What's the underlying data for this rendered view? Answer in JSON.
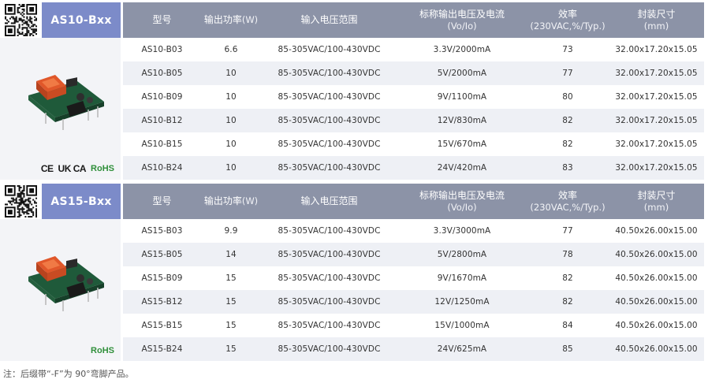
{
  "columns": [
    {
      "main": "型号",
      "sub": ""
    },
    {
      "main": "输出功率",
      "sub": "(W)"
    },
    {
      "main": "输入电压范围",
      "sub": ""
    },
    {
      "main": "标称输出电压及电流",
      "sub": "(Vo/Io)"
    },
    {
      "main": "效率",
      "sub": "(230VAC,%/Typ.)"
    },
    {
      "main": "封装尺寸",
      "sub": "(mm)"
    }
  ],
  "sections": [
    {
      "series": "AS10-Bxx",
      "certs": {
        "ce": "CE",
        "ukca": "UK CA",
        "rohs": "RoHS"
      },
      "rows": [
        [
          "AS10-B03",
          "6.6",
          "85-305VAC/100-430VDC",
          "3.3V/2000mA",
          "73",
          "32.00x17.20x15.05"
        ],
        [
          "AS10-B05",
          "10",
          "85-305VAC/100-430VDC",
          "5V/2000mA",
          "77",
          "32.00x17.20x15.05"
        ],
        [
          "AS10-B09",
          "10",
          "85-305VAC/100-430VDC",
          "9V/1100mA",
          "80",
          "32.00x17.20x15.05"
        ],
        [
          "AS10-B12",
          "10",
          "85-305VAC/100-430VDC",
          "12V/830mA",
          "82",
          "32.00x17.20x15.05"
        ],
        [
          "AS10-B15",
          "10",
          "85-305VAC/100-430VDC",
          "15V/670mA",
          "82",
          "32.00x17.20x15.05"
        ],
        [
          "AS10-B24",
          "10",
          "85-305VAC/100-430VDC",
          "24V/420mA",
          "83",
          "32.00x17.20x15.05"
        ]
      ]
    },
    {
      "series": "AS15-Bxx",
      "certs": {
        "rohs": "RoHS"
      },
      "rows": [
        [
          "AS15-B03",
          "9.9",
          "85-305VAC/100-430VDC",
          "3.3V/3000mA",
          "77",
          "40.50x26.00x15.00"
        ],
        [
          "AS15-B05",
          "14",
          "85-305VAC/100-430VDC",
          "5V/2800mA",
          "78",
          "40.50x26.00x15.00"
        ],
        [
          "AS15-B09",
          "15",
          "85-305VAC/100-430VDC",
          "9V/1670mA",
          "82",
          "40.50x26.00x15.00"
        ],
        [
          "AS15-B12",
          "15",
          "85-305VAC/100-430VDC",
          "12V/1250mA",
          "82",
          "40.50x26.00x15.00"
        ],
        [
          "AS15-B15",
          "15",
          "85-305VAC/100-430VDC",
          "15V/1000mA",
          "84",
          "40.50x26.00x15.00"
        ],
        [
          "AS15-B24",
          "15",
          "85-305VAC/100-430VDC",
          "24V/625mA",
          "85",
          "40.50x26.00x15.00"
        ]
      ]
    }
  ],
  "note": "注：后缀带“-F”为 90°弯脚产品。",
  "colors": {
    "series_tab": "#7c8bc9",
    "header": "#8c93a7",
    "alt_row": "#eef0f5",
    "left_panel": "#f3f4f7",
    "rohs": "#2f8f3a"
  }
}
